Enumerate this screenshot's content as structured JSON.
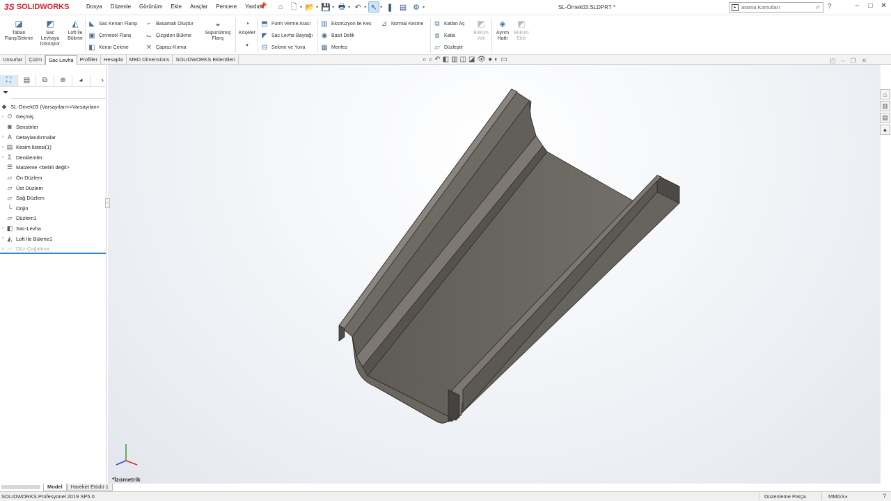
{
  "app": {
    "logo_ds": "3S",
    "logo_text": "SOLIDWORKS",
    "doc_title": "SL-Örnek03.SLDPRT *"
  },
  "menu": [
    "Dosya",
    "Düzenle",
    "Görünüm",
    "Ekle",
    "Araçlar",
    "Pencere",
    "Yardım"
  ],
  "search": {
    "placeholder": "arama Komutları"
  },
  "window_controls": [
    "–",
    "□",
    "✕"
  ],
  "ribbon": {
    "taban": "Taban Flanş/Sekme",
    "sac_donustur": "Sac Levhaya Dönüştür",
    "loft_bukme": "Loft İle Bükme",
    "sac_kenari": "Sac Kenarı Flanşı",
    "cevresel": "Çevresel Flanş",
    "kenar_cekme": "Kenar Çekme",
    "basamak": "Basamak Oluştur",
    "cizgiden": "Çizgiden Bükme",
    "capraz": "Çapraz-Kırma",
    "supurulmus": "Süpürülmüş Flanş",
    "koseler": "Köşeler",
    "form_verme": "Form Verme Aracı",
    "bayragi": "Sac Levha Bayrağı",
    "sekme_yuva": "Sekme ve Yuva",
    "ekstruzyon": "Ekstrüzyon ile Kes",
    "basit_delik": "Basit Delik",
    "menfez": "Menfez",
    "normal_kesme": "Normal Kesme",
    "katlan_ac": "Katlan Aç",
    "katla": "Katla",
    "duzlestir": "Düzleştir",
    "bukum_yok": "Büküm Yok",
    "ayrim": "Ayrım Hattı",
    "bukum_ekle": "Büküm Ekle"
  },
  "tabs": [
    {
      "label": "Unsurlar",
      "active": false
    },
    {
      "label": "Çizim",
      "active": false
    },
    {
      "label": "Sac Levha",
      "active": true
    },
    {
      "label": "Profiller",
      "active": false
    },
    {
      "label": "Hesapla",
      "active": false
    },
    {
      "label": "MBD Dimensions",
      "active": false
    },
    {
      "label": "SOLIDWORKS Eklentileri",
      "active": false
    }
  ],
  "tree": {
    "root": "SL-Örnek03  (Varsayılan<<Varsayılan>",
    "items": [
      {
        "label": "Geçmiş",
        "expandable": true,
        "icon": "history-icon"
      },
      {
        "label": "Sensörler",
        "expandable": false,
        "icon": "sensor-icon"
      },
      {
        "label": "Detaylandırmalar",
        "expandable": true,
        "icon": "annotation-icon"
      },
      {
        "label": "Kesim listesi(1)",
        "expandable": true,
        "icon": "cutlist-icon"
      },
      {
        "label": "Denklemler",
        "expandable": true,
        "icon": "equation-icon"
      },
      {
        "label": "Malzeme <belirli değil>",
        "expandable": false,
        "icon": "material-icon"
      },
      {
        "label": "Ön Düzlem",
        "expandable": false,
        "icon": "plane-icon"
      },
      {
        "label": "Üst Düzlem",
        "expandable": false,
        "icon": "plane-icon"
      },
      {
        "label": "Sağ Düzlem",
        "expandable": false,
        "icon": "plane-icon"
      },
      {
        "label": "Orijin",
        "expandable": false,
        "icon": "origin-icon"
      },
      {
        "label": "Düzlem1",
        "expandable": false,
        "icon": "plane-icon"
      },
      {
        "label": "Sac-Levha",
        "expandable": true,
        "icon": "sheetmetal-icon"
      },
      {
        "label": "Loft İle Bükme1",
        "expandable": true,
        "icon": "lofted-bend-icon"
      },
      {
        "label": "Düz-Çoğaltma",
        "expandable": true,
        "icon": "flat-pattern-icon",
        "suppressed": true
      }
    ]
  },
  "bottom_tabs": [
    "Model",
    "Hareket Etüdü 1"
  ],
  "view": {
    "name": "*İzometrik"
  },
  "status": {
    "left": "SOLIDWORKS Profesyonel 2019 SP5.0",
    "mode": "Düzenleme Parça",
    "unit": "MMGS"
  },
  "colors": {
    "part": "#6c6862",
    "accent": "#2e87d8",
    "logo": "#d8212f"
  }
}
